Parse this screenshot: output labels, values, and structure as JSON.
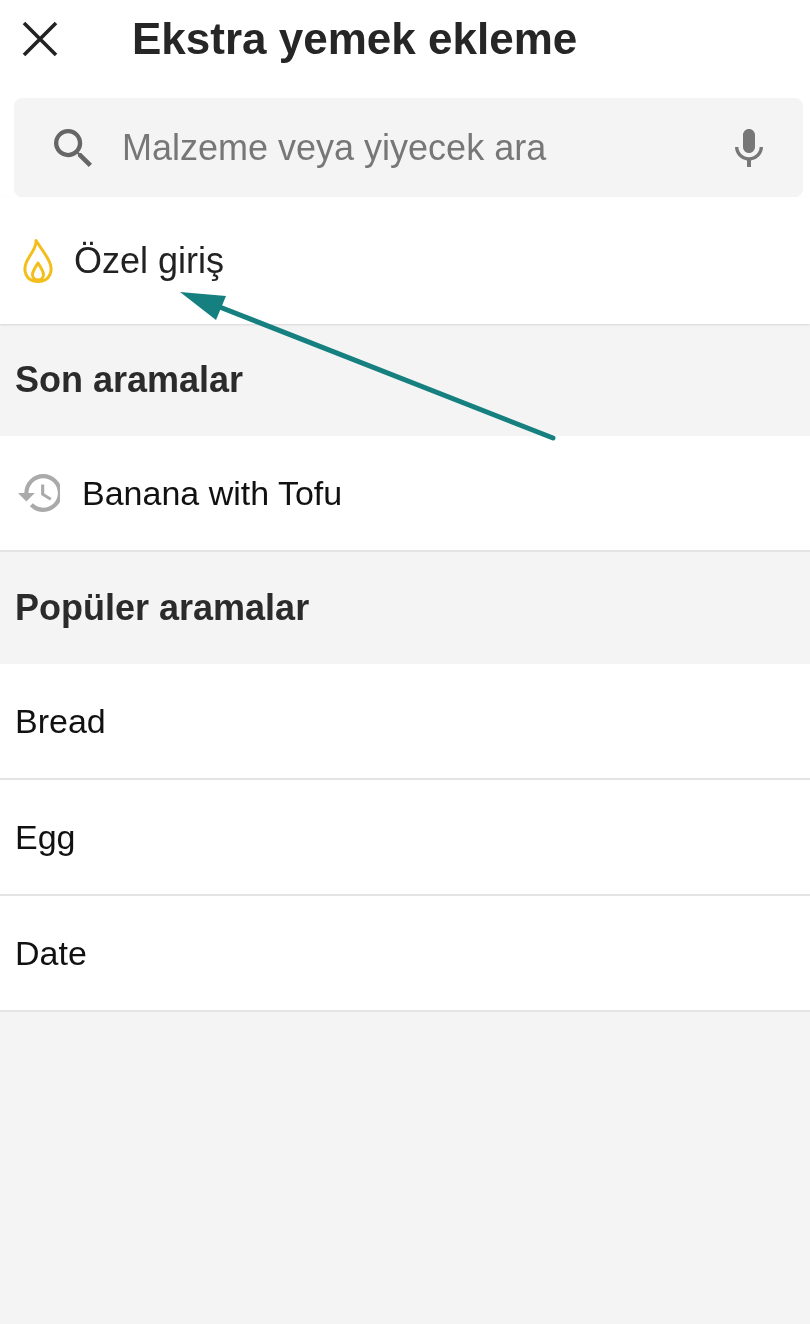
{
  "header": {
    "title": "Ekstra yemek ekleme"
  },
  "search": {
    "placeholder": "Malzeme veya yiyecek ara"
  },
  "custom_entry": {
    "label": "Özel giriş"
  },
  "sections": [
    {
      "title": "Son aramalar",
      "items": [
        {
          "kind": "history",
          "label": "Banana with Tofu"
        }
      ]
    },
    {
      "title": "Popüler aramalar",
      "items": [
        {
          "kind": "plain",
          "label": "Bread"
        },
        {
          "kind": "plain",
          "label": "Egg"
        },
        {
          "kind": "plain",
          "label": "Date"
        }
      ]
    }
  ]
}
